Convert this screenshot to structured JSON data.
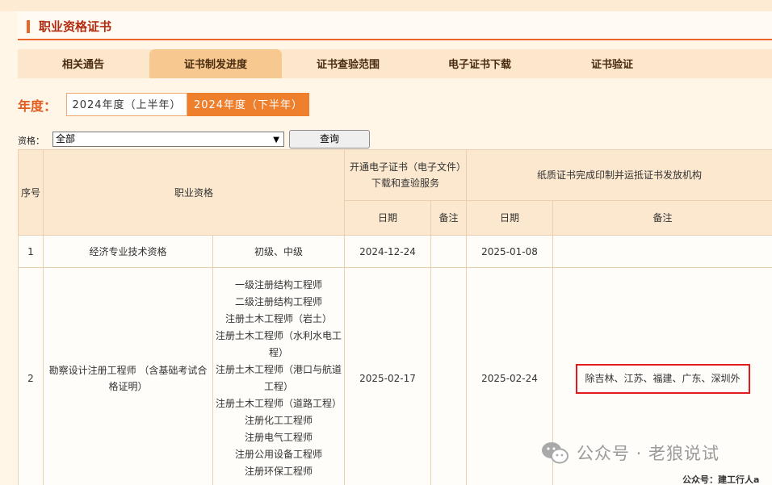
{
  "section_title": "职业资格证书",
  "tabs": [
    {
      "label": "相关通告",
      "active": false
    },
    {
      "label": "证书制发进度",
      "active": true
    },
    {
      "label": "证书查验范围",
      "active": false
    },
    {
      "label": "电子证书下载",
      "active": false
    },
    {
      "label": "证书验证",
      "active": false
    }
  ],
  "year": {
    "label": "年度：",
    "options": [
      "2024年度（上半年）",
      "2024年度（下半年）"
    ],
    "selected_index": 1
  },
  "filter": {
    "label": "资格：",
    "selected": "全部",
    "query_button": "查询"
  },
  "table": {
    "headers": {
      "seq": "序号",
      "qualification": "职业资格",
      "electronic_group": "开通电子证书（电子文件）下载和查验服务",
      "paper_group": "纸质证书完成印制并运抵证书发放机构",
      "e_date": "日期",
      "e_note": "备注",
      "p_date": "日期",
      "p_note": "备注"
    },
    "rows": [
      {
        "seq": "1",
        "name": "经济专业技术资格",
        "levels": [
          "初级、中级"
        ],
        "e_date": "2024-12-24",
        "e_note": "",
        "p_date": "2025-01-08",
        "p_note": ""
      },
      {
        "seq": "2",
        "name": "勘察设计注册工程师 （含基础考试合格证明）",
        "levels": [
          "一级注册结构工程师",
          "二级注册结构工程师",
          "注册土木工程师（岩土）",
          "注册土木工程师（水利水电工程）",
          "注册土木工程师（港口与航道工程）",
          "注册土木工程师（道路工程）",
          "注册化工工程师",
          "注册电气工程师",
          "注册公用设备工程师",
          "注册环保工程师"
        ],
        "e_date": "2025-02-17",
        "e_note": "",
        "p_date": "2025-02-24",
        "p_note": "除吉林、江苏、福建、广东、深圳外"
      }
    ]
  },
  "watermark": "公众号 · 老狼说试",
  "footer_text": "公众号：建工行人a",
  "colors": {
    "accent": "#e9652a",
    "highlight_border": "#e11b1b"
  }
}
